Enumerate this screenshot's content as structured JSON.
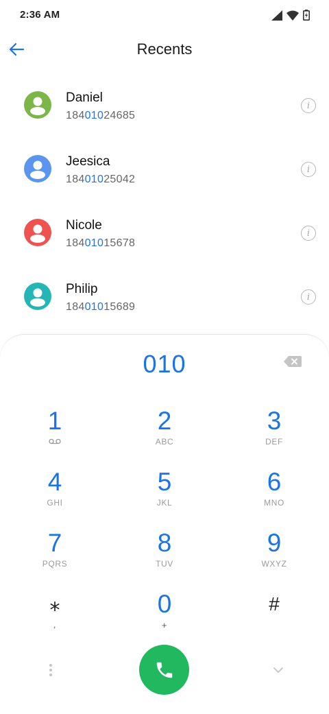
{
  "status_bar": {
    "time": "2:36 AM",
    "icons": [
      "signal-icon",
      "wifi-icon",
      "battery-charging-icon"
    ]
  },
  "header": {
    "back_icon": "arrow-left-icon",
    "title": "Recents"
  },
  "recents": [
    {
      "name": "Daniel",
      "number_prefix": "184",
      "number_match": "010",
      "number_suffix": "24685",
      "avatar_color": "#7cb548"
    },
    {
      "name": "Jeesica",
      "number_prefix": "184",
      "number_match": "010",
      "number_suffix": "25042",
      "avatar_color": "#5b95ef"
    },
    {
      "name": "Nicole",
      "number_prefix": "184",
      "number_match": "010",
      "number_suffix": "15678",
      "avatar_color": "#ef5350"
    },
    {
      "name": "Philip",
      "number_prefix": "184",
      "number_match": "010",
      "number_suffix": "15689",
      "avatar_color": "#26b5b5"
    }
  ],
  "info_glyph": "i",
  "dialer": {
    "dialed_number": "010",
    "keys": [
      {
        "digit": "1",
        "letters": "",
        "sub_icon": "voicemail-icon"
      },
      {
        "digit": "2",
        "letters": "ABC"
      },
      {
        "digit": "3",
        "letters": "DEF"
      },
      {
        "digit": "4",
        "letters": "GHI"
      },
      {
        "digit": "5",
        "letters": "JKL"
      },
      {
        "digit": "6",
        "letters": "MNO"
      },
      {
        "digit": "7",
        "letters": "PQRS"
      },
      {
        "digit": "8",
        "letters": "TUV"
      },
      {
        "digit": "9",
        "letters": "WXYZ"
      },
      {
        "digit": "⁎",
        "letters": ","
      },
      {
        "digit": "0",
        "letters": "+"
      },
      {
        "digit": "#",
        "letters": ""
      }
    ]
  },
  "colors": {
    "accent": "#1a73e8",
    "call_button": "#22b860"
  }
}
